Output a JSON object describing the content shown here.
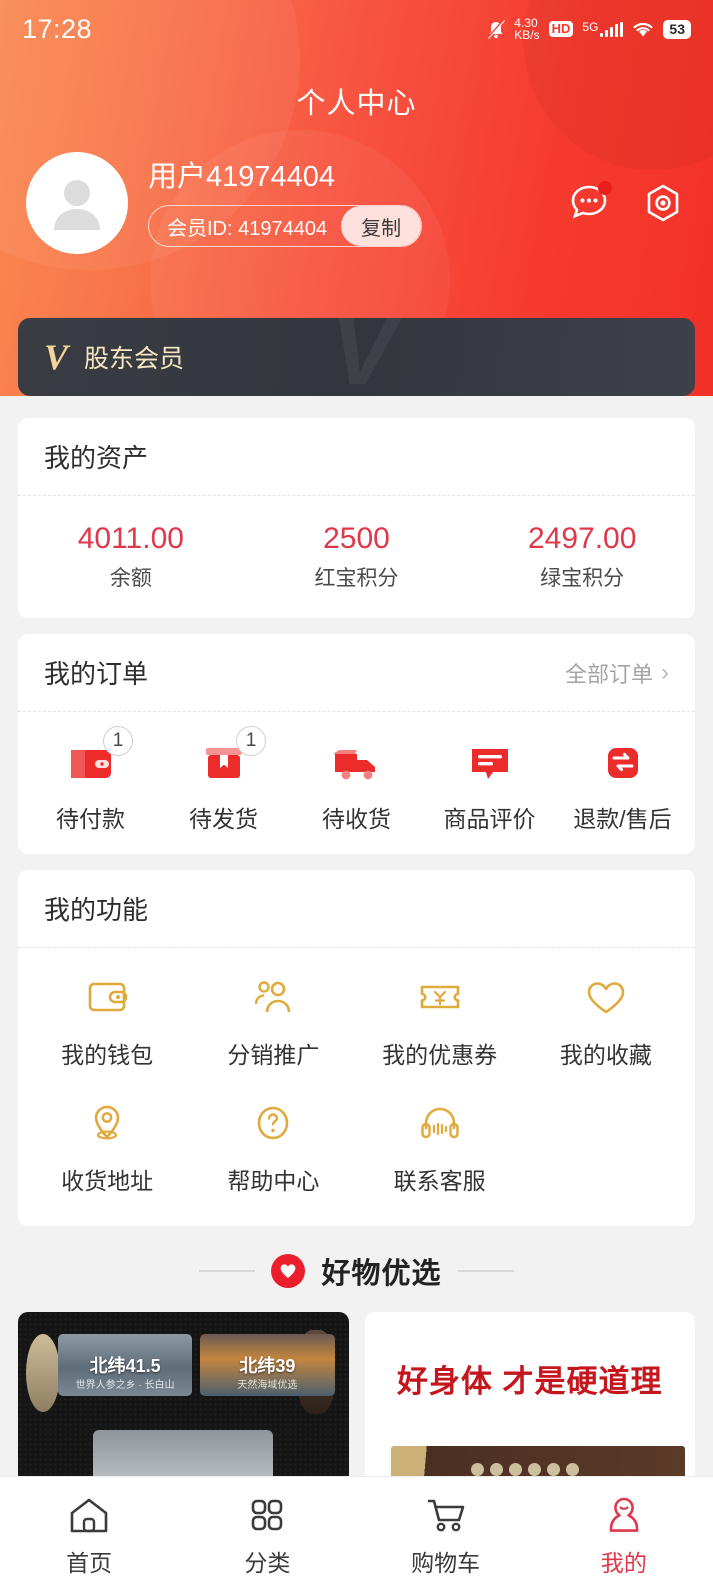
{
  "status_bar": {
    "time": "17:28",
    "net_speed_value": "4.30",
    "net_speed_unit": "KB/s",
    "hd_label": "HD",
    "network_type": "5G",
    "battery": "53",
    "icons": [
      "mute-bell-icon",
      "hd-icon",
      "signal-bars-icon",
      "wifi-icon",
      "battery-icon"
    ]
  },
  "header": {
    "title": "个人中心",
    "user_name": "用户41974404",
    "member_id_label": "会员ID: 41974404",
    "copy_label": "复制",
    "actions": [
      {
        "name": "message-icon",
        "has_badge": true
      },
      {
        "name": "settings-hexagon-icon",
        "has_badge": false
      }
    ],
    "gradient_from": "#fa8a52",
    "gradient_to": "#f23128"
  },
  "vip_banner": {
    "logo": "V",
    "label": "股东会员",
    "bg_color": "#3a3c43",
    "text_color": "#f6e7c4"
  },
  "assets": {
    "title": "我的资产",
    "value_color": "#e0384a",
    "items": [
      {
        "value": "4011.00",
        "label": "余额"
      },
      {
        "value": "2500",
        "label": "红宝积分"
      },
      {
        "value": "2497.00",
        "label": "绿宝积分"
      }
    ]
  },
  "orders": {
    "title": "我的订单",
    "more_label": "全部订单",
    "items": [
      {
        "label": "待付款",
        "icon": "wallet-icon",
        "badge": "1"
      },
      {
        "label": "待发货",
        "icon": "package-icon",
        "badge": "1"
      },
      {
        "label": "待收货",
        "icon": "truck-icon",
        "badge": ""
      },
      {
        "label": "商品评价",
        "icon": "comment-icon",
        "badge": ""
      },
      {
        "label": "退款/售后",
        "icon": "refund-icon",
        "badge": ""
      }
    ]
  },
  "functions": {
    "title": "我的功能",
    "icon_color": "#e0a93c",
    "row1": [
      {
        "label": "我的钱包",
        "icon": "wallet-outline-icon"
      },
      {
        "label": "分销推广",
        "icon": "people-icon"
      },
      {
        "label": "我的优惠券",
        "icon": "coupon-yuan-icon"
      },
      {
        "label": "我的收藏",
        "icon": "heart-outline-icon"
      }
    ],
    "row2": [
      {
        "label": "收货地址",
        "icon": "location-pin-icon"
      },
      {
        "label": "帮助中心",
        "icon": "question-circle-icon"
      },
      {
        "label": "联系客服",
        "icon": "headset-icon"
      }
    ]
  },
  "recommend": {
    "title": "好物优选",
    "icon": "heart-circle-icon",
    "accent": "#ea1f2b",
    "goods": [
      {
        "type": "dark-banner-card",
        "banner1_title": "北纬41.5",
        "banner1_sub": "世界人参之乡 · 长白山",
        "banner2_title": "北纬39",
        "banner2_sub": "天然海域优选"
      },
      {
        "type": "white-text-card",
        "headline": "好身体 才是硬道理"
      }
    ]
  },
  "tabbar": {
    "active_color": "#e0384a",
    "items": [
      {
        "label": "首页",
        "icon": "home-icon",
        "active": false
      },
      {
        "label": "分类",
        "icon": "grid-icon",
        "active": false
      },
      {
        "label": "购物车",
        "icon": "cart-icon",
        "active": false
      },
      {
        "label": "我的",
        "icon": "person-icon",
        "active": true
      }
    ]
  }
}
